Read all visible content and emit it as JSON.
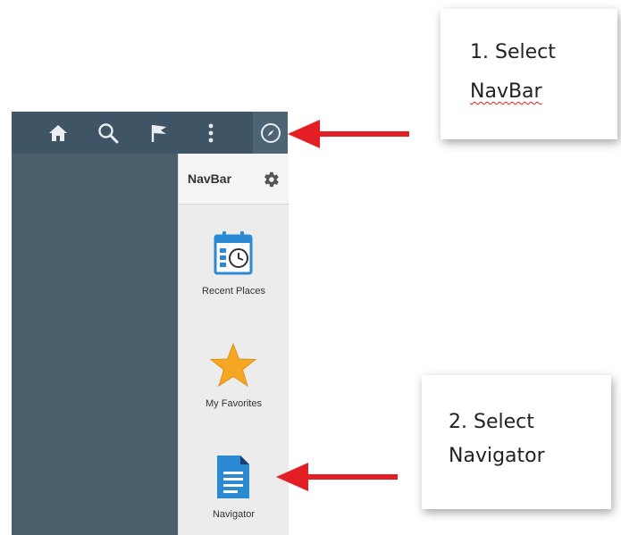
{
  "navbar": {
    "title": "NavBar",
    "tiles": [
      {
        "label": "Recent Places",
        "icon": "recent-places-icon"
      },
      {
        "label": "My Favorites",
        "icon": "star-icon"
      },
      {
        "label": "Navigator",
        "icon": "document-icon"
      }
    ]
  },
  "header_icons": [
    "home-icon",
    "search-icon",
    "flag-icon",
    "more-vertical-icon",
    "compass-icon"
  ],
  "callouts": {
    "step1": {
      "line1": "1. Select",
      "line2": "NavBar"
    },
    "step2": {
      "line1": "2. Select",
      "line2": "Navigator"
    }
  },
  "colors": {
    "header": "#3f5566",
    "panel": "#4a5e6c",
    "arrow": "#e31e24",
    "star": "#f5a623",
    "tile_blue": "#2a8ad4"
  }
}
